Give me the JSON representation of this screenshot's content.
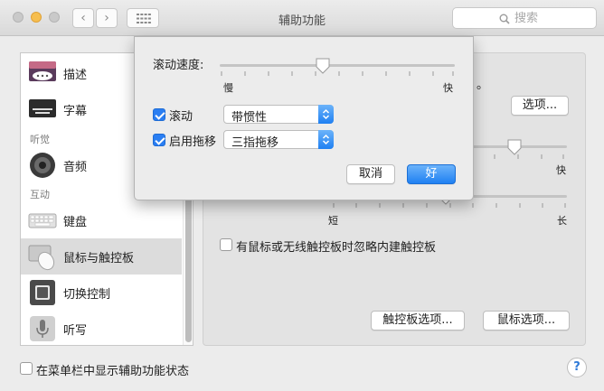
{
  "window": {
    "title": "辅助功能"
  },
  "search": {
    "placeholder": "搜索"
  },
  "sidebar": {
    "items": [
      {
        "label": "描述",
        "icon": "speech-bubble-icon"
      },
      {
        "label": "字幕",
        "icon": "captions-icon"
      },
      {
        "label": "音频",
        "icon": "speaker-icon"
      },
      {
        "label": "键盘",
        "icon": "keyboard-icon"
      },
      {
        "label": "鼠标与触控板",
        "icon": "mouse-trackpad-icon",
        "selected": true
      },
      {
        "label": "切换控制",
        "icon": "switch-control-icon"
      },
      {
        "label": "听写",
        "icon": "microphone-icon"
      }
    ],
    "headers": [
      "听觉",
      "互动"
    ]
  },
  "main": {
    "partial_text": "。",
    "options_button": "选项...",
    "speed_fast": "快",
    "delay_short": "短",
    "delay_long": "长",
    "ignore_trackpad_label": "有鼠标或无线触控板时忽略内建触控板",
    "trackpad_options_button": "触控板选项...",
    "mouse_options_button": "鼠标选项..."
  },
  "popover": {
    "scroll_speed_label": "滚动速度:",
    "slow_label": "慢",
    "fast_label": "快",
    "scroll_speed_level": 0.44,
    "scrolling_label": "滚动",
    "scrolling_checked": true,
    "scrolling_mode": "带惯性",
    "drag_label": "启用拖移",
    "drag_checked": true,
    "drag_mode": "三指拖移",
    "cancel_button": "取消",
    "ok_button": "好"
  },
  "footer": {
    "show_status_label": "在菜单栏中显示辅助功能状态",
    "show_status_checked": false,
    "help_label": "?"
  },
  "colors": {
    "accent": "#2a7ef2",
    "selected_row": "#dcdcdc"
  }
}
